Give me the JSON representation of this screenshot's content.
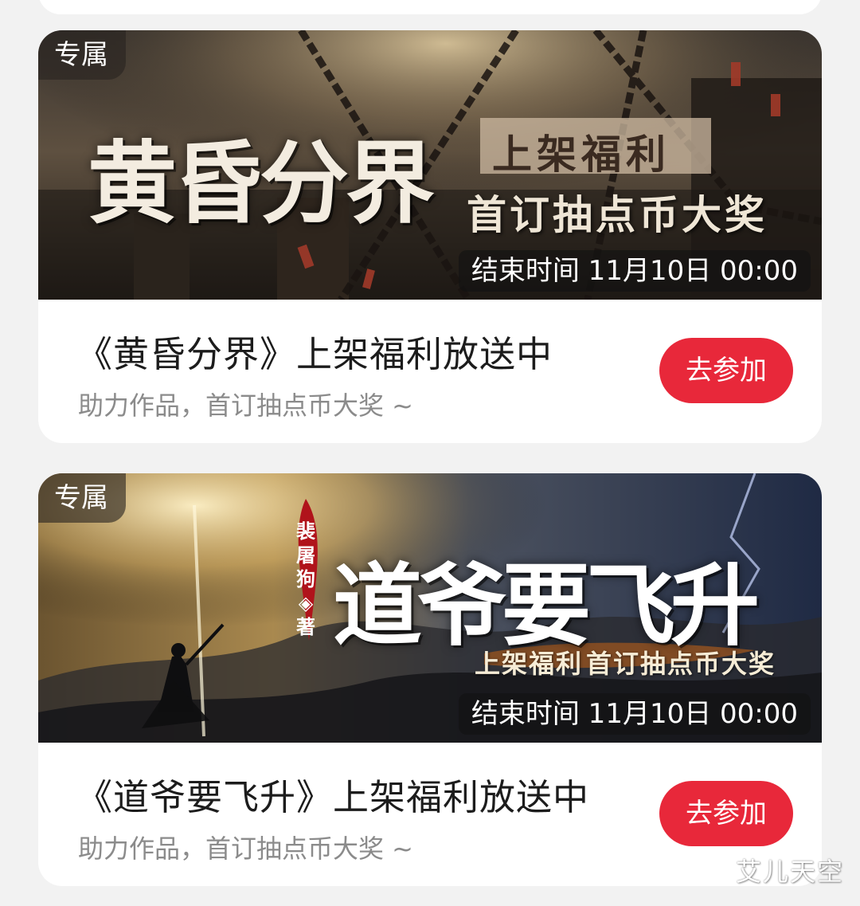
{
  "cards": [
    {
      "badge": "专属",
      "banner": {
        "title": "黄昏分界",
        "tag_1": "上架福利",
        "tag_2": "首订抽点币大奖",
        "end_time": "结束时间 11月10日 00:00"
      },
      "title": "《黄昏分界》上架福利放送中",
      "subtitle": "助力作品，首订抽点币大奖 ~",
      "button_label": "去参加"
    },
    {
      "badge": "专属",
      "banner": {
        "title": "道爷要飞升",
        "author": "裴屠狗◈著",
        "tag_1": "上架福利",
        "tag_2": "首订抽点币大奖",
        "end_time": "结束时间 11月10日 00:00"
      },
      "title": "《道爷要飞升》上架福利放送中",
      "subtitle": "助力作品，首订抽点币大奖 ~",
      "button_label": "去参加"
    }
  ],
  "watermark": "艾儿天空",
  "colors": {
    "accent": "#e8283a",
    "title_text": "#1c1c1c",
    "subtitle_text": "#8b8b8b",
    "card_bg": "#ffffff",
    "page_bg": "#f2f2f2"
  }
}
